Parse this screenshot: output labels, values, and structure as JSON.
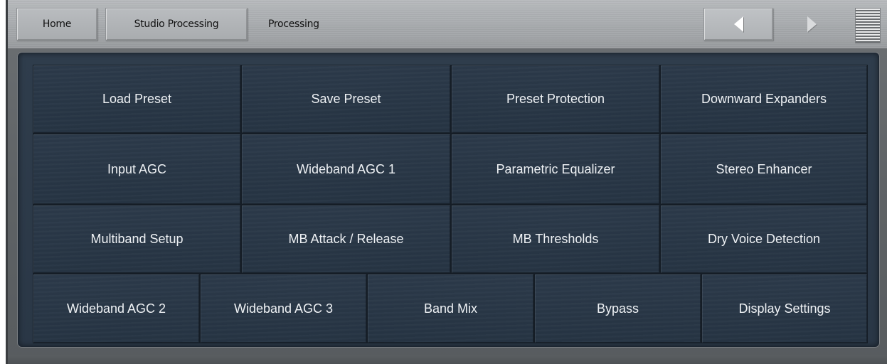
{
  "nav": {
    "breadcrumbs": [
      "Home",
      "Studio Processing",
      "Processing"
    ],
    "back_icon": "triangle-left-icon",
    "forward_icon": "triangle-right-icon",
    "menu_icon": "menu-lines-icon"
  },
  "grid": {
    "row1": [
      "Load Preset",
      "Save Preset",
      "Preset Protection",
      "Downward Expanders"
    ],
    "row2": [
      "Input AGC",
      "Wideband AGC 1",
      "Parametric Equalizer",
      "Stereo Enhancer"
    ],
    "row3": [
      "Multiband Setup",
      "MB Attack / Release",
      "MB Thresholds",
      "Dry Voice Detection"
    ],
    "row4": [
      "Wideband AGC 2",
      "Wideband AGC 3",
      "Band Mix",
      "Bypass",
      "Display Settings"
    ]
  },
  "colors": {
    "panel": "#2a3746",
    "tile_text": "#eef1f4",
    "topbar": "#a7aaad"
  }
}
